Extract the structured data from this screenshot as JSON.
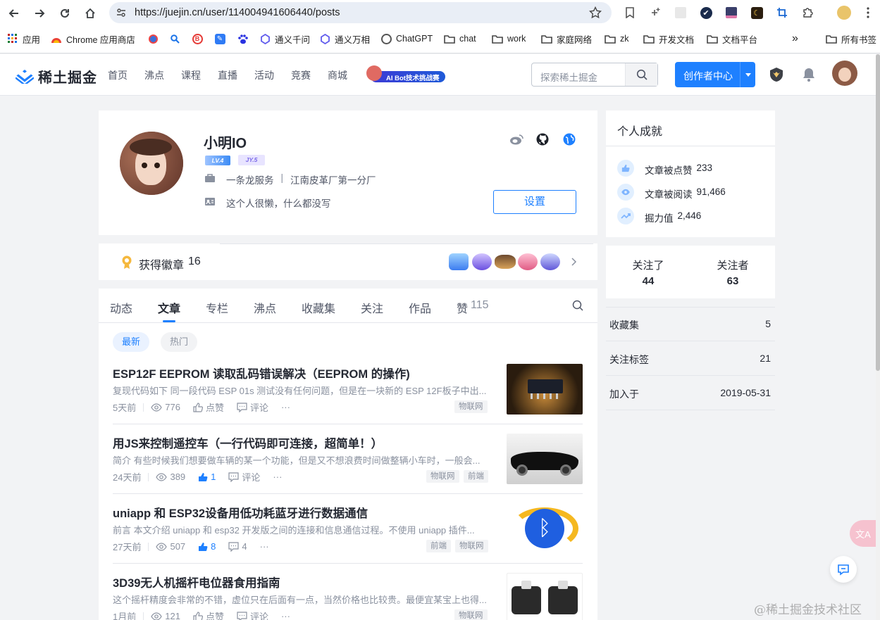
{
  "browser": {
    "url": "https://juejin.cn/user/114004941606440/posts",
    "bookmarks": [
      {
        "label": "应用",
        "icon": "apps-grid-icon"
      },
      {
        "label": "Chrome 应用商店",
        "icon": "chrome-web-store-icon"
      },
      {
        "label": "",
        "icon": "bookmark-site-icon"
      },
      {
        "label": "",
        "icon": "search-bookmark-icon"
      },
      {
        "label": "",
        "icon": "bookmark-site-icon"
      },
      {
        "label": "",
        "icon": "bookmark-site-icon"
      },
      {
        "label": "",
        "icon": "baidu-paw-icon"
      },
      {
        "label": "通义千问",
        "icon": "tongyi-icon"
      },
      {
        "label": "通义万相",
        "icon": "tongyi-icon"
      },
      {
        "label": "ChatGPT",
        "icon": "chatgpt-icon"
      },
      {
        "label": "chat",
        "icon": "folder-icon"
      },
      {
        "label": "work",
        "icon": "folder-icon"
      },
      {
        "label": "家庭网络",
        "icon": "folder-icon"
      },
      {
        "label": "zk",
        "icon": "folder-icon"
      },
      {
        "label": "开发文档",
        "icon": "folder-icon"
      },
      {
        "label": "文档平台",
        "icon": "folder-icon"
      }
    ],
    "more_bookmarks": "»",
    "all_bookmarks": "所有书签"
  },
  "header": {
    "logo_text": "稀土掘金",
    "nav": [
      "首页",
      "沸点",
      "课程",
      "直播",
      "活动",
      "竞赛",
      "商城"
    ],
    "banner_text": "AI Bot技术挑战赛",
    "search_placeholder": "探索稀土掘金",
    "creator_button": "创作者中心"
  },
  "profile": {
    "name": "小明IO",
    "level_badge": "LV.4",
    "jy_badge": "JY.5",
    "job": "一条龙服务",
    "company": "江南皮革厂第一分厂",
    "job_sep": "|",
    "bio": "这个人很懒，什么都没写",
    "settings_button": "设置"
  },
  "badges": {
    "label": "获得徽章",
    "count": "16"
  },
  "tabs": [
    {
      "label": "动态",
      "count": ""
    },
    {
      "label": "文章",
      "count": "",
      "active": true
    },
    {
      "label": "专栏",
      "count": ""
    },
    {
      "label": "沸点",
      "count": ""
    },
    {
      "label": "收藏集",
      "count": ""
    },
    {
      "label": "关注",
      "count": ""
    },
    {
      "label": "作品",
      "count": ""
    },
    {
      "label": "赞",
      "count": "115"
    }
  ],
  "sort": {
    "latest": "最新",
    "hot": "热门"
  },
  "articles": [
    {
      "title": "ESP12F EEPROM 读取乱码错误解决（EEPROM 的操作)",
      "abstract": "复现代码如下 同一段代码 ESP 01s 测试没有任何问题，但是在一块新的 ESP 12F板子中出...",
      "time": "5天前",
      "views": "776",
      "likes": "点赞",
      "comments": "评论",
      "liked": false,
      "tags": [
        "物联网"
      ]
    },
    {
      "title": "用JS来控制遥控车（一行代码即可连接，超简单！）",
      "abstract": "简介 有些时候我们想要做车辆的某一个功能，但是又不想浪费时间做整辆小车时，一般会...",
      "time": "24天前",
      "views": "389",
      "likes": "1",
      "comments": "评论",
      "liked": true,
      "tags": [
        "物联网",
        "前端"
      ]
    },
    {
      "title": "uniapp 和 ESP32设备用低功耗蓝牙进行数据通信",
      "abstract": "前言 本文介绍 uniapp 和 esp32 开发版之间的连接和信息通信过程。不使用 uniapp 插件...",
      "time": "27天前",
      "views": "507",
      "likes": "8",
      "comments": "4",
      "liked": true,
      "tags": [
        "前端",
        "物联网"
      ]
    },
    {
      "title": "3D39无人机摇杆电位器食用指南",
      "abstract": "这个摇杆精度会非常的不错，虚位只在后面有一点，当然价格也比较贵。最便宜某宝上也得...",
      "time": "1月前",
      "views": "121",
      "likes": "点赞",
      "comments": "评论",
      "liked": false,
      "tags": [
        "物联网"
      ]
    }
  ],
  "achievements": {
    "title": "个人成就",
    "items": [
      {
        "label": "文章被点赞",
        "value": "233"
      },
      {
        "label": "文章被阅读",
        "value": "91,466"
      },
      {
        "label": "掘力值",
        "value": "2,446"
      }
    ]
  },
  "follow": {
    "following_label": "关注了",
    "following": "44",
    "followers_label": "关注者",
    "followers": "63"
  },
  "stats": [
    {
      "label": "收藏集",
      "value": "5"
    },
    {
      "label": "关注标签",
      "value": "21"
    },
    {
      "label": "加入于",
      "value": "2019-05-31"
    }
  ],
  "watermark": "@稀土掘金技术社区",
  "colors": {
    "brand": "#1e80ff",
    "text": "#252933",
    "muted": "#8a919f"
  }
}
